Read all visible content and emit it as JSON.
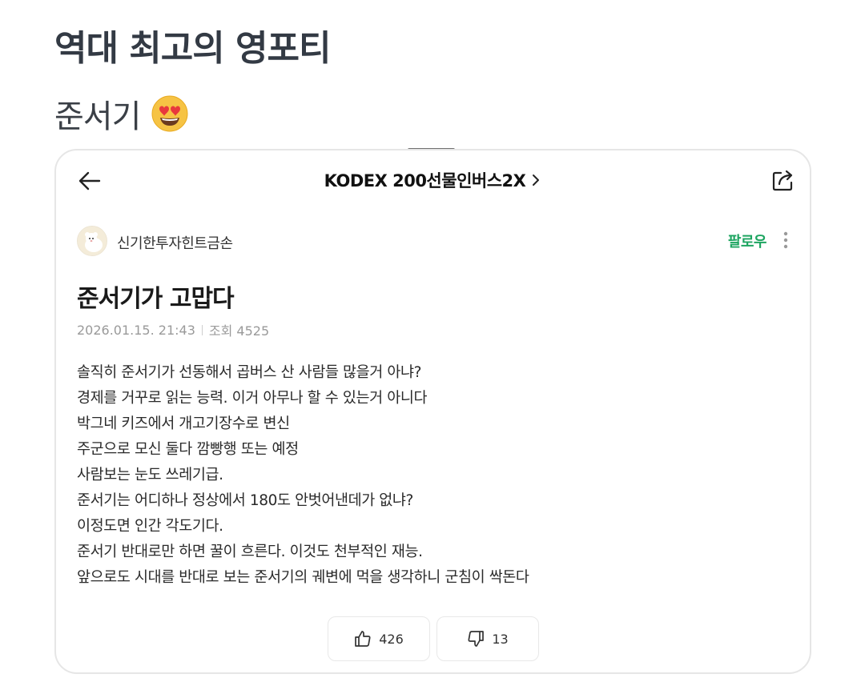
{
  "header": {
    "title": "역대 최고의 영포티",
    "subtitle": "준서기"
  },
  "nav": {
    "title": "KODEX 200선물인버스2X"
  },
  "author": {
    "name": "신기한투자힌트금손",
    "follow_label": "팔로우"
  },
  "post": {
    "title": "준서기가 고맙다",
    "date": "2026.01.15. 21:43",
    "views": "조회 4525",
    "body": [
      "솔직히 준서기가 선동해서 곱버스 산 사람들 많을거 아냐?",
      "경제를 거꾸로 읽는 능력. 이거 아무나 할 수 있는거 아니다",
      "박그네 키즈에서 개고기장수로 변신",
      "주군으로 모신 둘다 깜빵행 또는 예정",
      "사람보는 눈도 쓰레기급.",
      "준서기는 어디하나 정상에서 180도 안벗어낸데가 없냐?",
      "이정도면 인간 각도기다.",
      "준서기 반대로만 하면 꿀이 흐른다. 이것도 천부적인 재능.",
      "앞으로도 시대를 반대로 보는 준서기의 궤변에 먹을 생각하니 군침이 싹돈다"
    ]
  },
  "reactions": {
    "like_count": "426",
    "dislike_count": "13"
  },
  "colors": {
    "follow": "#1ea561",
    "title_text": "#333a44",
    "meta_text": "#9a9a9a"
  },
  "icons": {
    "emoji": "heart-eyes-emoji-icon",
    "back": "arrow-left-icon",
    "share": "share-icon",
    "more": "more-vertical-icon",
    "like": "thumbs-up-icon",
    "dislike": "thumbs-down-icon"
  }
}
